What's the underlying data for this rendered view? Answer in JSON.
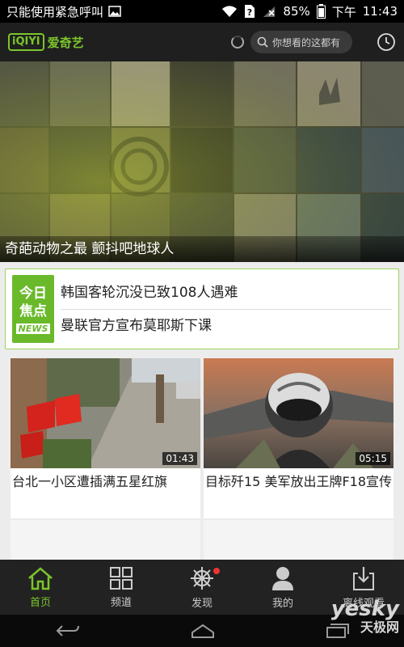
{
  "status_bar": {
    "carrier_text": "只能使用紧急呼叫",
    "battery": "85%",
    "ampm": "下午",
    "time": "11:43"
  },
  "header": {
    "logo_box": "iQIYI",
    "logo_text": "爱奇艺",
    "search_placeholder": "你想看的这都有"
  },
  "hero": {
    "caption": "奇葩动物之最 颤抖吧地球人"
  },
  "focus": {
    "badge_line1": "今日",
    "badge_line2": "焦点",
    "badge_line3": "NEWS",
    "items": [
      "韩国客轮沉没已致108人遇难",
      "曼联官方宣布莫耶斯下课"
    ]
  },
  "videos": [
    {
      "title": "台北一小区遭插满五星红旗",
      "duration": "01:43"
    },
    {
      "title": "目标歼15 美军放出王牌F18宣传",
      "duration": "05:15"
    }
  ],
  "nav": [
    {
      "label": "首页",
      "icon": "home-icon",
      "active": true
    },
    {
      "label": "频道",
      "icon": "grid-icon"
    },
    {
      "label": "发现",
      "icon": "wheel-icon"
    },
    {
      "label": "我的",
      "icon": "user-icon"
    },
    {
      "label": "离线观看",
      "icon": "download-icon"
    }
  ],
  "watermark": {
    "line1": "yesky",
    "line2": "天极网"
  },
  "colors": {
    "accent": "#7bc52b",
    "badge": "#6ab92a",
    "dark": "#1f1f1f"
  }
}
